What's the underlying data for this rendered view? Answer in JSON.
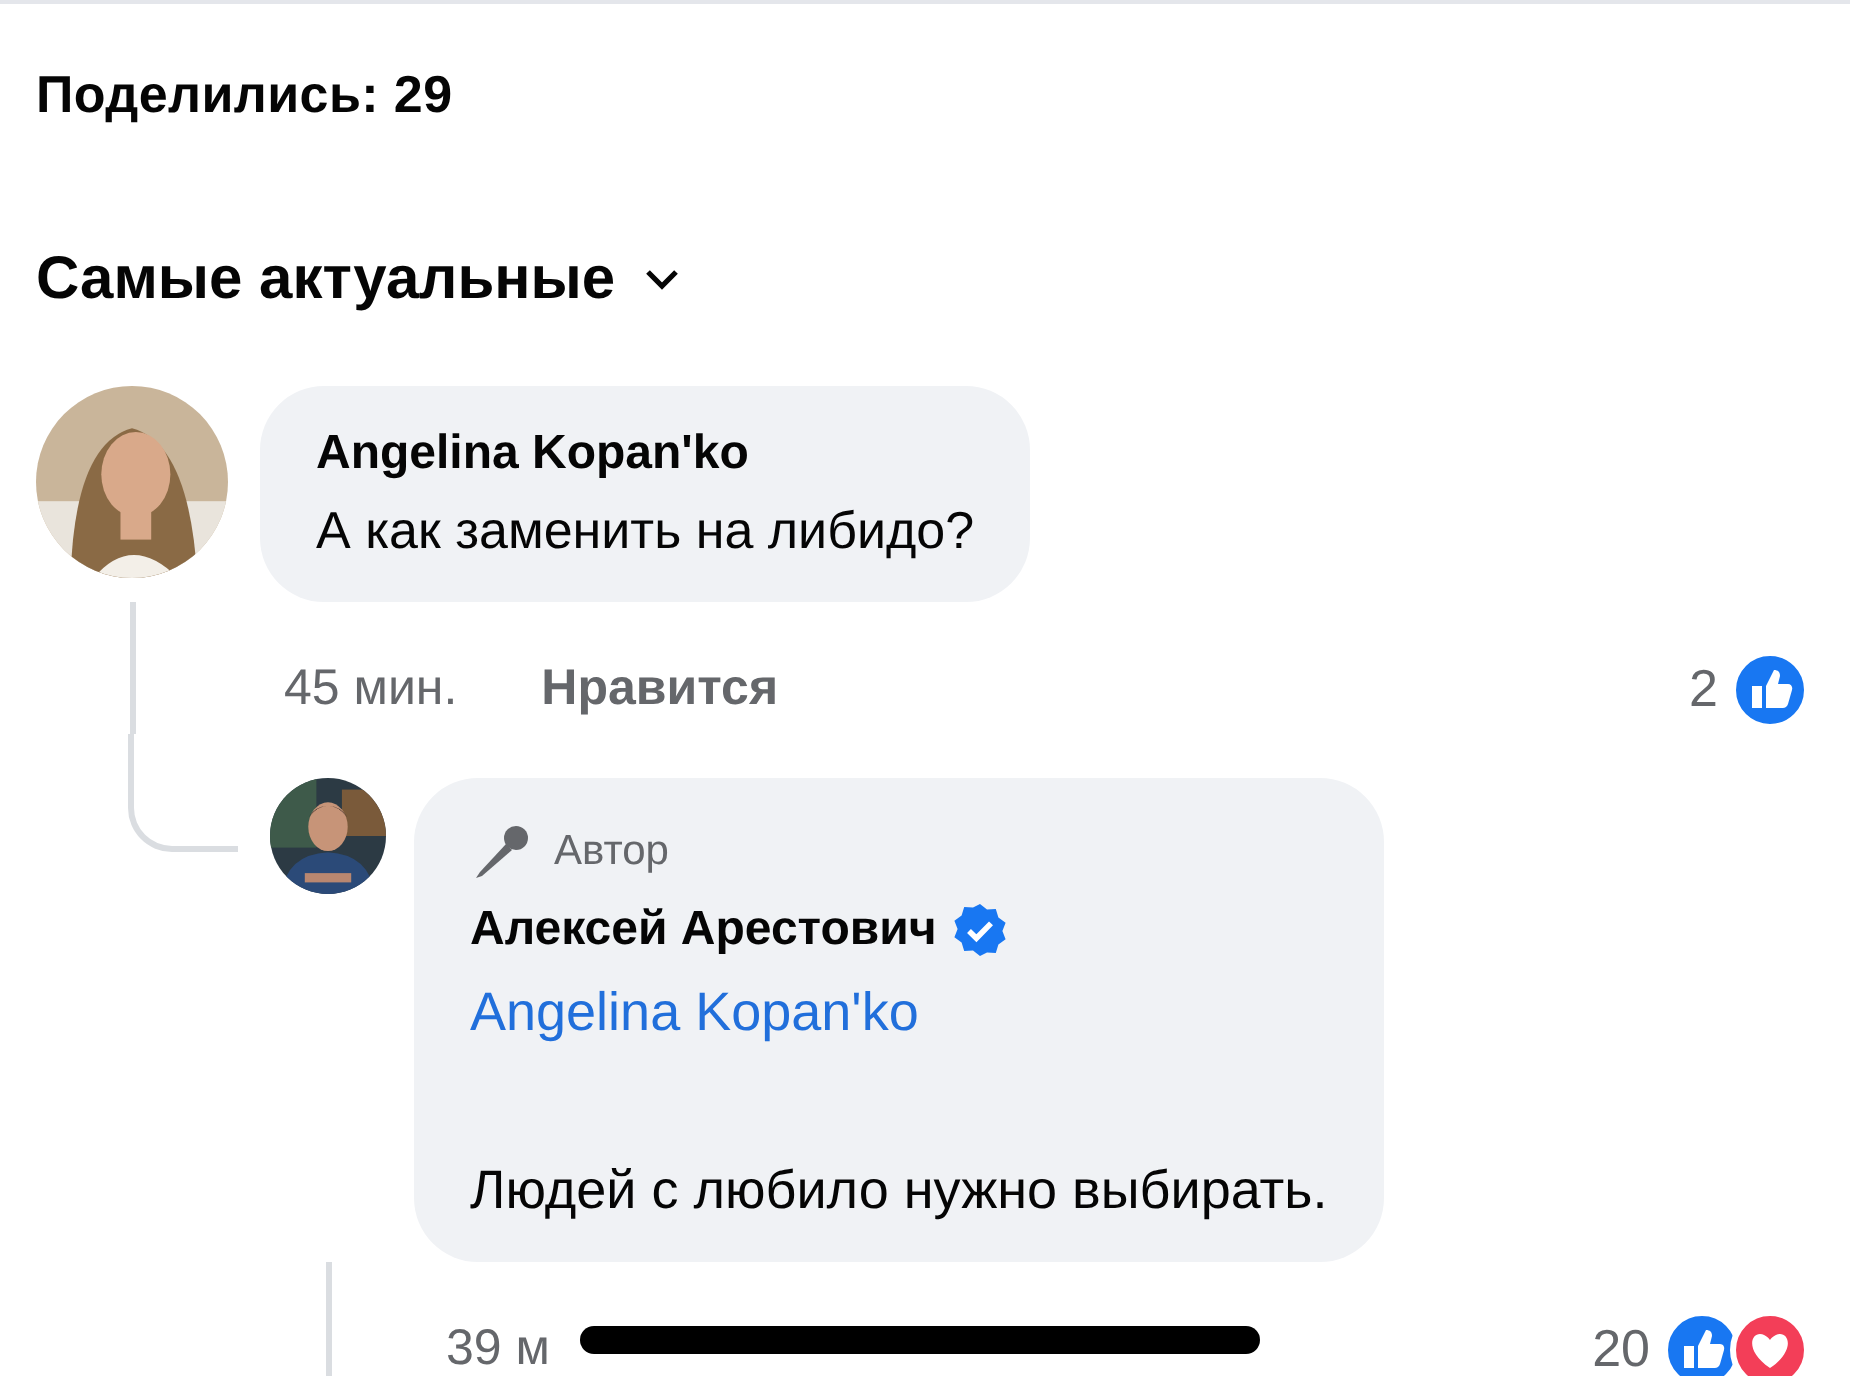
{
  "shares": "Поделились: 29",
  "sort": {
    "label": "Самые актуальные"
  },
  "comments": [
    {
      "avatar": {
        "kind": "picture"
      },
      "author": "Angelina Kopan'ko",
      "text": "А как заменить на либидо?",
      "time": "45 мин.",
      "like_label": "Нравится",
      "reaction_count": "2",
      "reactions": [
        {
          "kind": "like"
        }
      ],
      "replies": [
        {
          "avatar": {
            "kind": "picture"
          },
          "badge": "Автор",
          "author": "Алексей Арестович",
          "verified": true,
          "mention": "Angelina Kopan'ko",
          "text": "Людей с любило нужно выбирать.",
          "time": "39 м",
          "reaction_count": "20",
          "reactions": [
            {
              "kind": "like"
            },
            {
              "kind": "love"
            }
          ]
        }
      ]
    }
  ]
}
